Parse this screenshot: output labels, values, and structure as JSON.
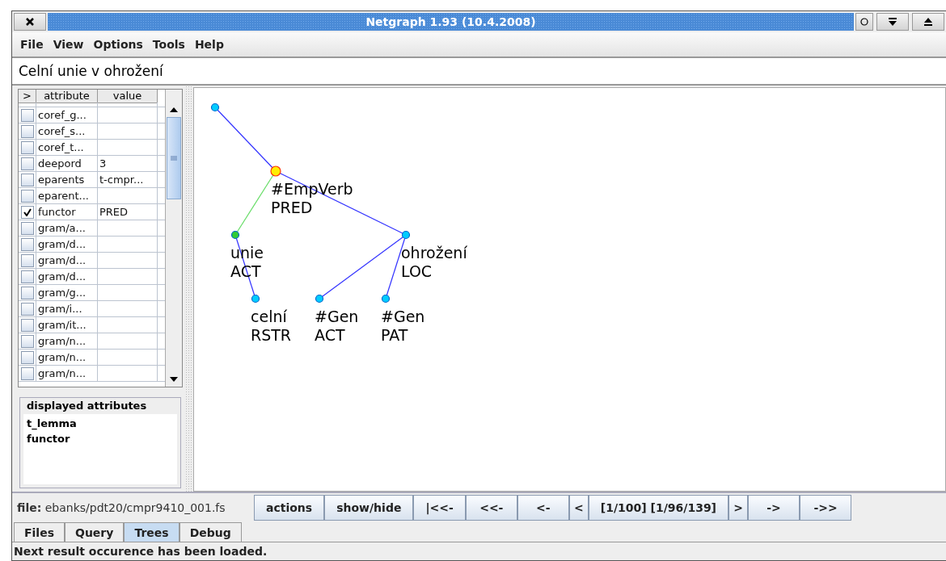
{
  "window": {
    "title": "Netgraph 1.93 (10.4.2008)"
  },
  "menu": [
    "File",
    "View",
    "Options",
    "Tools",
    "Help"
  ],
  "sentence": "Celní unie v ohrožení",
  "attributes": {
    "columns": [
      ">",
      "attribute",
      "value"
    ],
    "rows": [
      {
        "name": "coref_g...",
        "value": "",
        "checked": false
      },
      {
        "name": "coref_s...",
        "value": "",
        "checked": false
      },
      {
        "name": "coref_t...",
        "value": "",
        "checked": false
      },
      {
        "name": "deepord",
        "value": "3",
        "checked": false
      },
      {
        "name": "eparents",
        "value": "t-cmpr...",
        "checked": false
      },
      {
        "name": "eparent...",
        "value": "",
        "checked": false
      },
      {
        "name": "functor",
        "value": "PRED",
        "checked": true
      },
      {
        "name": "gram/a...",
        "value": "",
        "checked": false
      },
      {
        "name": "gram/d...",
        "value": "",
        "checked": false
      },
      {
        "name": "gram/d...",
        "value": "",
        "checked": false
      },
      {
        "name": "gram/d...",
        "value": "",
        "checked": false
      },
      {
        "name": "gram/g...",
        "value": "",
        "checked": false
      },
      {
        "name": "gram/i...",
        "value": "",
        "checked": false
      },
      {
        "name": "gram/it...",
        "value": "",
        "checked": false
      },
      {
        "name": "gram/n...",
        "value": "",
        "checked": false
      },
      {
        "name": "gram/n...",
        "value": "",
        "checked": false
      },
      {
        "name": "gram/n...",
        "value": "",
        "checked": false
      }
    ]
  },
  "displayed_attributes": {
    "title": "displayed attributes",
    "items": [
      "t_lemma",
      "functor"
    ]
  },
  "tree": {
    "color": "#00ccff",
    "selected": false,
    "children": [
      {
        "color": "#ffee00",
        "selected": true,
        "edge": {
          "color": "#3333ff"
        },
        "labels": [
          "#EmpVerb",
          "PRED"
        ],
        "children": [
          {
            "color": "#33cc33",
            "selected": false,
            "edge": {
              "color": "#66dd66"
            },
            "labels": [
              "unie",
              "ACT"
            ],
            "children": [
              {
                "color": "#00ccff",
                "selected": false,
                "edge": {
                  "color": "#3333ff"
                },
                "labels": [
                  "celní",
                  "RSTR"
                ]
              }
            ]
          },
          {
            "color": "#00ccff",
            "selected": false,
            "edge": {
              "color": "#3333ff"
            },
            "labels": [
              "ohrožení",
              "LOC"
            ],
            "children": [
              {
                "color": "#00ccff",
                "selected": false,
                "edge": {
                  "color": "#3333ff"
                },
                "labels": [
                  "#Gen",
                  "ACT"
                ]
              },
              {
                "color": "#00ccff",
                "selected": false,
                "edge": {
                  "color": "#3333ff"
                },
                "labels": [
                  "#Gen",
                  "PAT"
                ]
              }
            ]
          }
        ]
      }
    ]
  },
  "file_label": "**file:** ebanks/pdt20/cmpr9410_001.fs",
  "buttons": [
    "actions",
    "show/hide",
    "|<<-",
    "<<-",
    "<-",
    "<",
    "[1/100]  [1/96/139]",
    ">",
    "->",
    "->>"
  ],
  "tabs": [
    {
      "label": "Files",
      "selected": false
    },
    {
      "label": "Query",
      "selected": false
    },
    {
      "label": "Trees",
      "selected": true
    },
    {
      "label": "Debug",
      "selected": false
    }
  ],
  "status": "Next result occurence has been loaded."
}
